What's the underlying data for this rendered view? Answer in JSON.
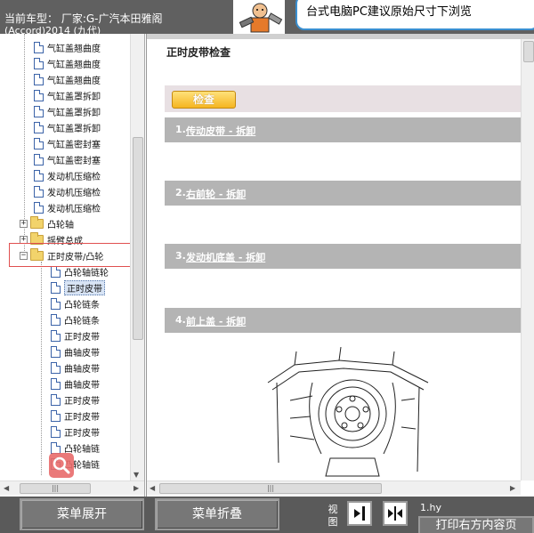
{
  "header": {
    "vehicle_line1": "当前车型： 厂家:G-广汽本田雅阁",
    "vehicle_line2": "(Accord)2014 (九代)",
    "tip_text": "台式电脑PC建议原始尺寸下浏览"
  },
  "tree": {
    "items": [
      {
        "label": "气缸盖翘曲度",
        "type": "doc"
      },
      {
        "label": "气缸盖翘曲度",
        "type": "doc"
      },
      {
        "label": "气缸盖翘曲度",
        "type": "doc"
      },
      {
        "label": "气缸盖罩拆卸",
        "type": "doc"
      },
      {
        "label": "气缸盖罩拆卸",
        "type": "doc"
      },
      {
        "label": "气缸盖罩拆卸",
        "type": "doc"
      },
      {
        "label": "气缸盖密封塞",
        "type": "doc"
      },
      {
        "label": "气缸盖密封塞",
        "type": "doc"
      },
      {
        "label": "发动机压缩检",
        "type": "doc"
      },
      {
        "label": "发动机压缩检",
        "type": "doc"
      },
      {
        "label": "发动机压缩检",
        "type": "doc"
      },
      {
        "label": "凸轮轴",
        "type": "folder",
        "expander": "+"
      },
      {
        "label": "摇臂总成",
        "type": "folder",
        "expander": "+"
      },
      {
        "label": "正时皮带/凸轮",
        "type": "folder",
        "expander": "-"
      },
      {
        "label": "凸轮轴链轮",
        "type": "doc"
      },
      {
        "label": "正时皮带",
        "type": "doc",
        "selected": true
      },
      {
        "label": "凸轮链条",
        "type": "doc"
      },
      {
        "label": "凸轮链条",
        "type": "doc"
      },
      {
        "label": "正时皮带",
        "type": "doc"
      },
      {
        "label": "曲轴皮带",
        "type": "doc"
      },
      {
        "label": "曲轴皮带",
        "type": "doc"
      },
      {
        "label": "曲轴皮带",
        "type": "doc"
      },
      {
        "label": "正时皮带",
        "type": "doc"
      },
      {
        "label": "正时皮带",
        "type": "doc"
      },
      {
        "label": "正时皮带",
        "type": "doc"
      },
      {
        "label": "凸轮轴链",
        "type": "doc"
      },
      {
        "label": "凸轮轴链",
        "type": "doc"
      }
    ]
  },
  "content": {
    "title": "正时皮带检查",
    "check_button": "检查",
    "sections": [
      {
        "num": "1.",
        "label": "传动皮带 - 拆卸"
      },
      {
        "num": "2.",
        "label": "右前轮 - 拆卸"
      },
      {
        "num": "3.",
        "label": "发动机底盖 - 拆卸"
      },
      {
        "num": "4.",
        "label": "前上盖 - 拆卸"
      }
    ]
  },
  "footer": {
    "expand_menu": "菜单展开",
    "collapse_menu": "菜单折叠",
    "view_label": "视图",
    "file_name": "1.hy",
    "print_label": "打印右方内容页"
  },
  "colors": {
    "header_bg": "#606060",
    "footer_bg": "#5a5a5a",
    "section_bar": "#b4b4b4",
    "check_button": "#f5b521",
    "tip_border": "#3a8fd0",
    "highlight": "#e05050"
  },
  "icons": {
    "document": "document-icon",
    "folder": "folder-icon",
    "search": "search-icon"
  }
}
